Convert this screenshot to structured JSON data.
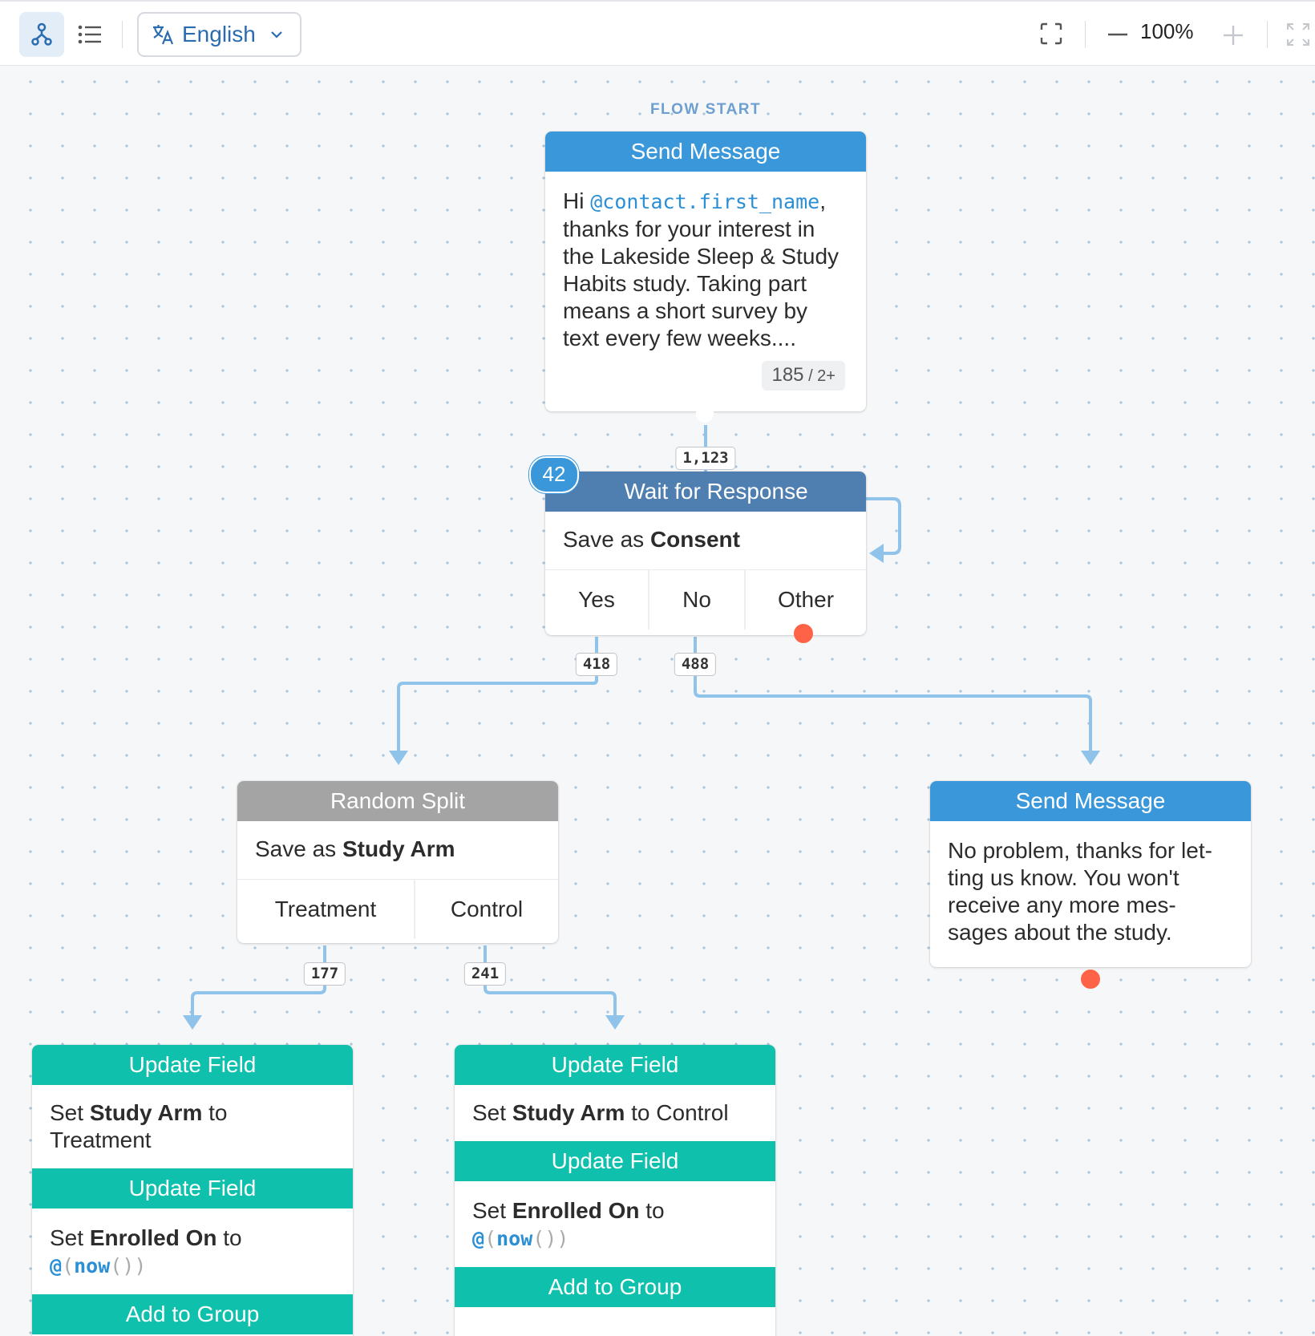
{
  "toolbar": {
    "language": "English",
    "zoom": "100%",
    "icons": [
      "flow-view-icon",
      "list-view-icon",
      "translate-icon",
      "chevron-down-icon",
      "fit-screen-icon",
      "zoom-out-icon",
      "zoom-in-icon",
      "fullscreen-icon"
    ]
  },
  "canvas": {
    "flow_start_label": "FLOW START",
    "nodes": {
      "send1": {
        "header": "Send Message",
        "greeting": "Hi ",
        "expression": "@contact.first_name",
        "comma": ",",
        "text": "thanks for your interest in the Lakeside Sleep & Study Habits study. Taking part means a short survey by text every few weeks....",
        "char_count": "185",
        "segments": " / 2+",
        "exit_count": "1,123"
      },
      "wait": {
        "active_count": "42",
        "header": "Wait for Response",
        "save_prefix": "Save as ",
        "result_name": "Consent",
        "exits": [
          {
            "label": "Yes",
            "count": "418"
          },
          {
            "label": "No",
            "count": "488"
          },
          {
            "label": "Other"
          }
        ]
      },
      "split": {
        "header": "Random Split",
        "save_prefix": "Save as ",
        "result_name": "Study Arm",
        "exits": [
          {
            "label": "Treatment",
            "count": "177"
          },
          {
            "label": "Control",
            "count": "241"
          }
        ]
      },
      "send2": {
        "header": "Send Message",
        "text": "No problem, thanks for let-ting us know. You won't receive any more mes-sages about the study."
      },
      "update_treatment": {
        "actions": [
          {
            "header": "Update Field",
            "prefix": "Set ",
            "field": "Study Arm",
            "mid": " to ",
            "value": "Treatment"
          },
          {
            "header": "Update Field",
            "prefix": "Set ",
            "field": "Enrolled On",
            "mid": " to",
            "expr_at": "@",
            "expr_open": "(",
            "expr_fn": "now",
            "expr_close": "())"
          }
        ],
        "footer_header": "Add to Group"
      },
      "update_control": {
        "actions": [
          {
            "header": "Update Field",
            "prefix": "Set ",
            "field": "Study Arm",
            "mid": " to ",
            "value": "Control"
          },
          {
            "header": "Update Field",
            "prefix": "Set ",
            "field": "Enrolled On",
            "mid": " to",
            "expr_at": "@",
            "expr_open": "(",
            "expr_fn": "now",
            "expr_close": "())"
          }
        ],
        "footer_header": "Add to Group"
      }
    }
  },
  "colors": {
    "send_message": "#3a98da",
    "wait_for_response": "#4f7fb0",
    "random_split": "#a4a4a4",
    "update_field": "#0fc1ac",
    "connector": "#8fc3ea",
    "terminal_dot": "#ff6347"
  }
}
